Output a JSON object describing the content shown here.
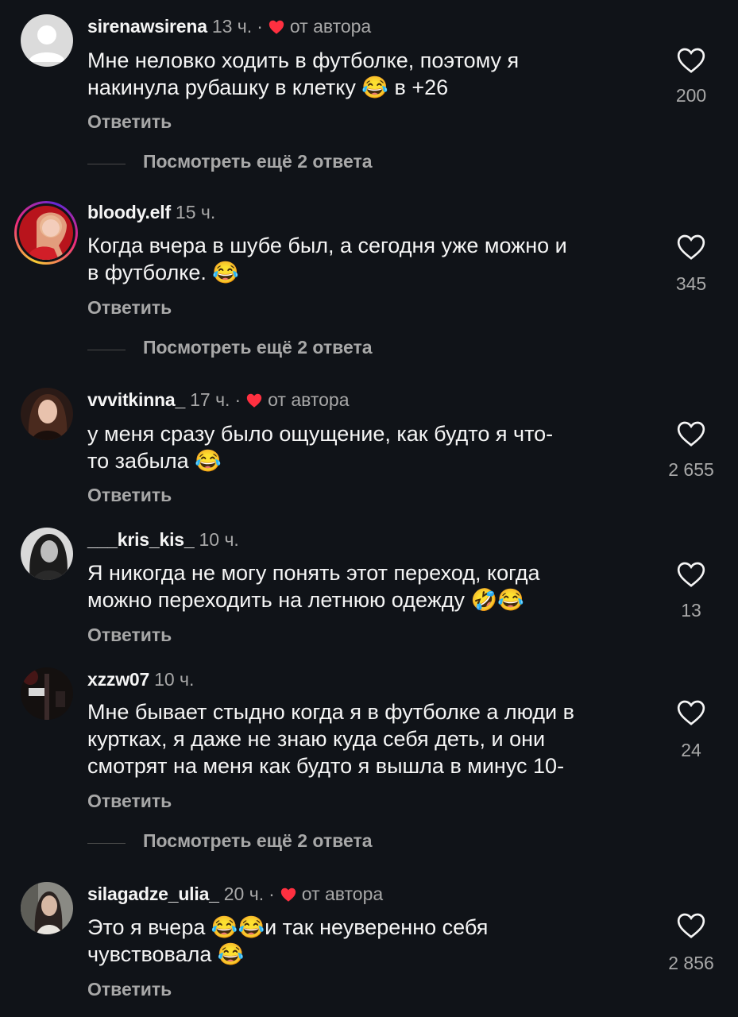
{
  "comments": [
    {
      "username": "sirenawsirena",
      "time": "13 ч.",
      "author_liked": true,
      "author_label": "от автора",
      "text_lines": [
        "Мне неловко ходить в футболке, поэтому я",
        "накинула рубашку в клетку 😂 в +26"
      ],
      "reply_label": "Ответить",
      "likes": "200",
      "more_replies": "Посмотреть ещё 2 ответа",
      "avatar": "default-avatar-icon"
    },
    {
      "username": "bloody.elf",
      "time": "15 ч.",
      "author_liked": false,
      "text_lines": [
        "Когда вчера в шубе был, а сегодня уже можно и",
        "в футболке. 😂"
      ],
      "reply_label": "Ответить",
      "likes": "345",
      "more_replies": "Посмотреть ещё 2 ответа",
      "avatar": "photo-avatar-story-ring"
    },
    {
      "username": "vvvitkinna_",
      "time": "17 ч.",
      "author_liked": true,
      "author_label": "от автора",
      "text_lines": [
        "у меня сразу было ощущение, как будто я что-",
        "то забыла 😂"
      ],
      "reply_label": "Ответить",
      "likes": "2 655",
      "avatar": "photo-avatar"
    },
    {
      "username": "___kris_kis_",
      "time": "10 ч.",
      "author_liked": false,
      "text_lines": [
        "Я никогда не могу понять этот переход, когда",
        "можно переходить на летнюю одежду 🤣😂"
      ],
      "reply_label": "Ответить",
      "likes": "13",
      "avatar": "photo-avatar-bw"
    },
    {
      "username": "xzzw07",
      "time": "10 ч.",
      "author_liked": false,
      "text_lines": [
        "Мне бывает стыдно когда я в футболке а люди в",
        "куртках, я даже не знаю куда себя деть, и они",
        "смотрят на меня как будто я вышла в минус 10-"
      ],
      "reply_label": "Ответить",
      "likes": "24",
      "more_replies": "Посмотреть ещё 2 ответа",
      "avatar": "photo-avatar-dark"
    },
    {
      "username": "silagadze_ulia_",
      "time": "20 ч.",
      "author_liked": true,
      "author_label": "от автора",
      "text_lines": [
        "Это я вчера 😂😂и так неуверенно себя",
        "чувствовала 😂"
      ],
      "reply_label": "Ответить",
      "likes": "2 856",
      "avatar": "photo-avatar"
    }
  ],
  "colors": {
    "background": "#101318",
    "text": "#f5f5f5",
    "secondary_text": "#a8a8a8",
    "author_heart": "#ff3040"
  }
}
